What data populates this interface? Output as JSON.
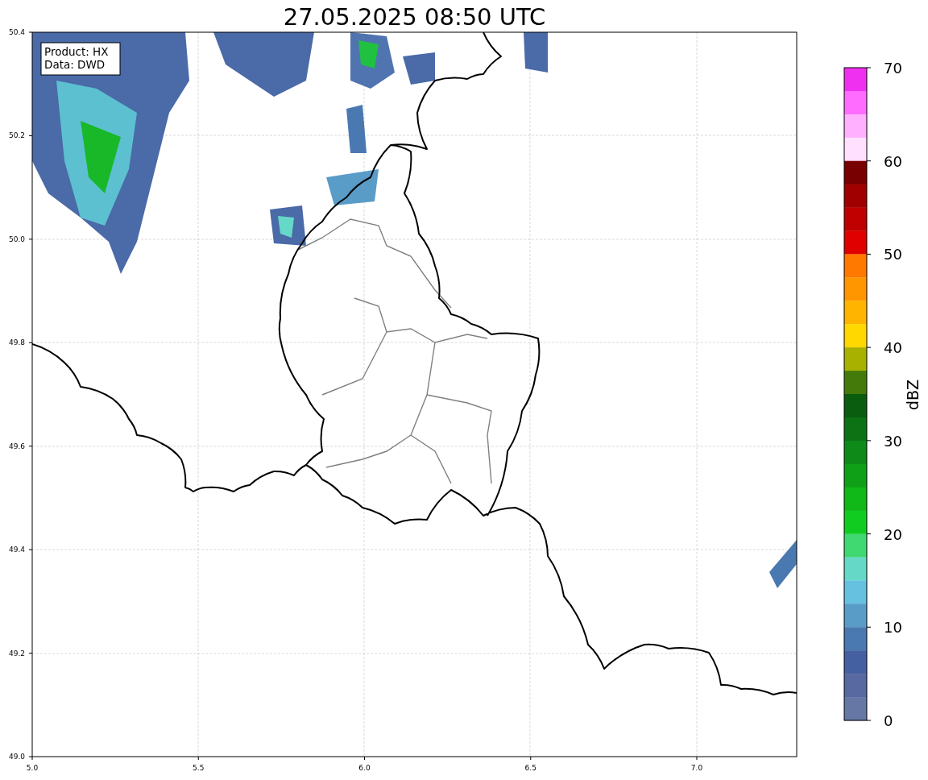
{
  "title": "27.05.2025 08:50 UTC",
  "annotation": {
    "lines": [
      "Product: HX",
      "Data: DWD"
    ]
  },
  "map": {
    "xticks": [
      "5.0",
      "5.5",
      "6.0",
      "6.5",
      "7.0"
    ],
    "yticks": [
      "50.4",
      "50.2",
      "50.0",
      "49.8",
      "49.6",
      "49.4",
      "49.2",
      "49.0"
    ]
  },
  "colorbar": {
    "label": "dBZ",
    "ticks": [
      "70",
      "60",
      "50",
      "40",
      "30",
      "20",
      "10",
      "0"
    ],
    "bins": [
      {
        "color": "#f030f0"
      },
      {
        "color": "#ff6cff"
      },
      {
        "color": "#ffb0ff"
      },
      {
        "color": "#ffe0ff"
      },
      {
        "color": "#780000"
      },
      {
        "color": "#a00000"
      },
      {
        "color": "#c00000"
      },
      {
        "color": "#e00000"
      },
      {
        "color": "#ff7800"
      },
      {
        "color": "#ff9600"
      },
      {
        "color": "#ffb400"
      },
      {
        "color": "#ffd800"
      },
      {
        "color": "#a8b000"
      },
      {
        "color": "#447a0a"
      },
      {
        "color": "#0a5c0e"
      },
      {
        "color": "#0c7214"
      },
      {
        "color": "#0e8a18"
      },
      {
        "color": "#10a018"
      },
      {
        "color": "#10b818"
      },
      {
        "color": "#10cc20"
      },
      {
        "color": "#40d870"
      },
      {
        "color": "#66d8c8"
      },
      {
        "color": "#66c0e0"
      },
      {
        "color": "#5a9cc8"
      },
      {
        "color": "#4a78b0"
      },
      {
        "color": "#4560a0"
      },
      {
        "color": "#5868a0"
      },
      {
        "color": "#6677a6"
      }
    ]
  }
}
